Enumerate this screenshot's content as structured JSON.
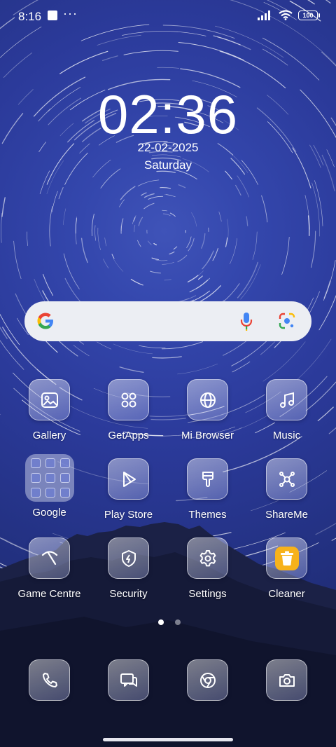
{
  "status_bar": {
    "time": "8:16",
    "more": "···",
    "battery": "100",
    "icons": [
      "notification-square-icon",
      "signal-icon",
      "wifi-icon",
      "battery-icon"
    ]
  },
  "lock": {
    "clock": "02:36",
    "date": "22-02-2025",
    "day": "Saturday"
  },
  "search_bar": {
    "icons": [
      "google-g-icon",
      "microphone-icon",
      "google-lens-icon"
    ]
  },
  "apps": {
    "gallery": "Gallery",
    "getapps": "GetApps",
    "mibrowser": "Mi Browser",
    "music": "Music",
    "google": "Google",
    "playstore": "Play Store",
    "themes": "Themes",
    "shareme": "ShareMe",
    "gamecentre": "Game Centre",
    "security": "Security",
    "settings": "Settings",
    "cleaner": "Cleaner"
  },
  "dock": {
    "icons": [
      "phone-icon",
      "messages-icon",
      "chrome-icon",
      "camera-icon"
    ]
  },
  "pager": {
    "pages": 2,
    "current": 1
  },
  "colors": {
    "accent_cleaner": "#f7b21b",
    "search_bg": "#eceef3"
  }
}
